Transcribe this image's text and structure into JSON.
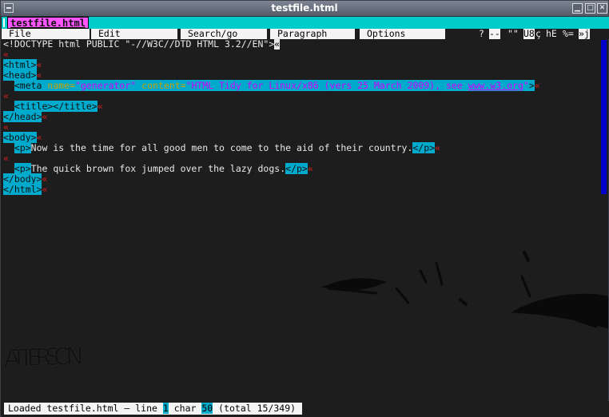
{
  "window": {
    "title": "testfile.html"
  },
  "tab": {
    "label": "testfile.html"
  },
  "menu": {
    "items": [
      "File",
      "Edit",
      "Search/go",
      "Paragraph",
      "Options"
    ],
    "indicators": {
      "help": "?",
      "dashes": "--",
      "quotes": "\"\"",
      "charset": "U8",
      "cedilla": "ç",
      "he": "hE",
      "percent": "%=",
      "last": "»j"
    }
  },
  "editor": {
    "doctype": "<!DOCTYPE html PUBLIC \"-//W3C//DTD HTML 3.2//EN\">",
    "html_open": "<html>",
    "head_open": "<head>",
    "meta_open": "<meta",
    "attr_name": "name=",
    "attr_name_val": "\"generator\"",
    "attr_content": "content=",
    "content_val_start": "\"HTML Tidy for Linux/x86 (vers 25 March 2009), see ",
    "content_url": "www.w3.org",
    "content_val_end": "\"",
    "meta_close": ">",
    "title_tags": "<title></title>",
    "head_close": "</head>",
    "body_open": "<body>",
    "p_open": "<p>",
    "p_close": "</p>",
    "para1": "Now is the time for all good men to come to the aid of their country.",
    "para2": "The quick brown fox jumped over the lazy dogs.",
    "body_close": "</body>",
    "html_close": "</html>",
    "return_mark": "«"
  },
  "wallpaper": {
    "signature": "ATTERSON"
  },
  "status": {
    "prefix": "Loaded testfile.html — line ",
    "line": "1",
    "char_label": " char ",
    "char": "50",
    "total": " (total 15/349)"
  },
  "colors": {
    "tab_bg": "#00cccc",
    "tab_active": "#ff55ff",
    "tag_bg": "#00aacc",
    "return_mark": "#d42020",
    "attr": "#c8a000",
    "value": "#d000ff",
    "scrollbar": "#0000cc"
  }
}
